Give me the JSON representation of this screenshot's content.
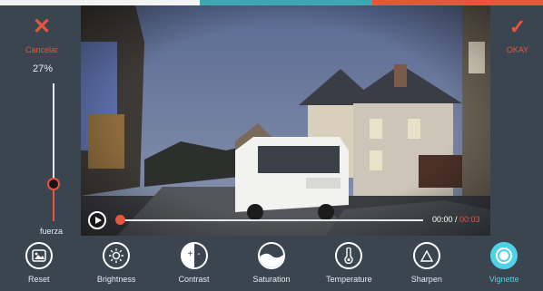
{
  "colors": {
    "accent": "#e8553e",
    "active": "#4fd2e8",
    "panel": "#3a4550",
    "strip": [
      "#f3f3f3",
      "#3fa7b2",
      "#e8553e"
    ]
  },
  "header": {
    "cancel_label": "Cancelar",
    "cancel_icon": "close-icon",
    "okay_label": "OKAY",
    "okay_icon": "check-icon"
  },
  "strength": {
    "percent_text": "27%",
    "value": 0.27,
    "label": "fuerza"
  },
  "player": {
    "current_time": "00:00",
    "separator": " / ",
    "duration": "00:03",
    "progress": 0.0
  },
  "tools": [
    {
      "label": "Reset",
      "icon": "image-icon"
    },
    {
      "label": "Brightness",
      "icon": "sun-icon"
    },
    {
      "label": "Contrast",
      "icon": "contrast-icon"
    },
    {
      "label": "Saturation",
      "icon": "saturation-icon"
    },
    {
      "label": "Temperature",
      "icon": "thermometer-icon"
    },
    {
      "label": "Sharpen",
      "icon": "triangle-icon"
    },
    {
      "label": "Vignette",
      "icon": "vignette-icon",
      "active": true
    }
  ]
}
